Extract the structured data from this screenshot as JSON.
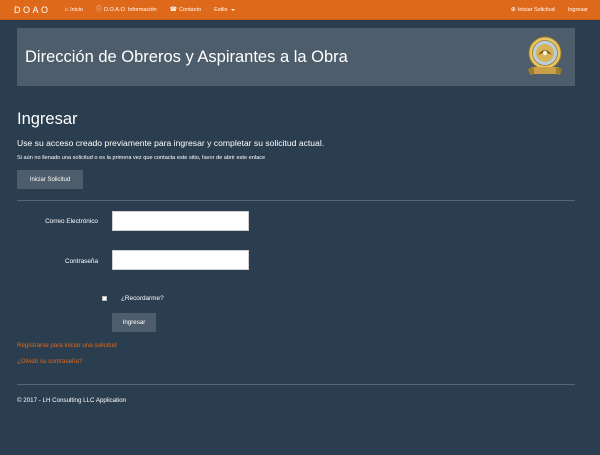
{
  "navbar": {
    "brand": "DOAO",
    "items": [
      {
        "label": "Inicio",
        "icon": "home-icon"
      },
      {
        "label": "D.O.A.O. Información",
        "icon": "info-icon"
      },
      {
        "label": "Contacto",
        "icon": "phone-icon"
      },
      {
        "label": "Estilo",
        "icon": "caret-down-icon"
      }
    ],
    "right_items": [
      {
        "label": "Iniciar Solicitud",
        "icon": "add-icon"
      },
      {
        "label": "Ingresar"
      }
    ]
  },
  "header": {
    "title": "Dirección de Obreros y Aspirantes a la Obra",
    "logo": "seal-icon"
  },
  "login": {
    "heading": "Ingresar",
    "lead": "Use su acceso creado previamente para ingresar y completar su solicitud actual.",
    "note": "Si aún no llenado una solicitud o es la primera vez que contacta este sitio, favor de abrir este enlace",
    "start_button": "Iniciar Solicitud",
    "email_label": "Correo Electrónico",
    "email_value": "",
    "password_label": "Contraseña",
    "password_value": "",
    "remember_label": "¿Recordarme?",
    "submit_button": "Ingresar",
    "register_link": "Registrarse para iniciar una solicitud",
    "forgot_link": "¿Olvidó su contraseña?"
  },
  "footer": {
    "text": "© 2017 - LH Consulting LLC Application"
  },
  "colors": {
    "navbar": "#df691a",
    "background": "#2b3e50",
    "panel": "#4e5d6c",
    "link": "#df691a"
  }
}
